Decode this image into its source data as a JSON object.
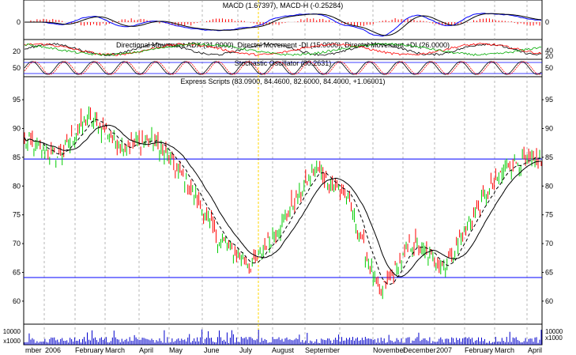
{
  "chart_data": [
    {
      "type": "line",
      "panel": "macd",
      "title": "MACD (1.67397), MACD-H (-0.25284)",
      "yticks": [
        0
      ],
      "series": [
        {
          "name": "MACD",
          "color": "#0000ff"
        },
        {
          "name": "MACD-H",
          "color": "#ff0000"
        }
      ]
    },
    {
      "type": "line",
      "panel": "dmi",
      "title": "Directional Movement ADX (31.0000), Directnl Movement -DI (15.0000), Directnl Movement +DI (26.0000)",
      "yticks": [
        20
      ],
      "yticks_right": [
        40,
        20
      ],
      "series": [
        {
          "name": "Directional Movement ADX",
          "value": 31.0,
          "color": "#000000"
        },
        {
          "name": "Directnl Movement -DI",
          "value": 15.0,
          "color": "#ff0000"
        },
        {
          "name": "Directnl Movement +DI",
          "value": 26.0,
          "color": "#00aa00"
        }
      ]
    },
    {
      "type": "line",
      "panel": "stochastic",
      "title": "Stochastic Oscillator (80.2631)",
      "yticks": [
        50
      ],
      "value": 80.2631
    },
    {
      "type": "line",
      "panel": "price",
      "title": "Express Scripts (83.0900, 84.4600, 82.6000, 84.4000, +1.06001)",
      "ylim": [
        56,
        99
      ],
      "yticks": [
        95,
        90,
        85,
        80,
        75,
        70,
        65,
        60
      ],
      "horizontal_lines": [
        84.7,
        64.1
      ],
      "x": [
        "Dec",
        "Jan 2006",
        "Feb",
        "Mar",
        "Apr",
        "May",
        "Jun",
        "Jul",
        "Aug",
        "Sep",
        "Oct",
        "Nov",
        "Dec",
        "Jan 2007",
        "Feb",
        "Mar",
        "Apr"
      ],
      "series": [
        {
          "name": "Close",
          "values": [
            88,
            85,
            92,
            87,
            88,
            81,
            71,
            66,
            74,
            83,
            78,
            61,
            70,
            66,
            76,
            84,
            84.4
          ]
        }
      ]
    },
    {
      "type": "bar",
      "panel": "volume",
      "yticks": [
        "10000",
        "x1000"
      ],
      "yticks_right": [
        "10000",
        "x1000"
      ]
    }
  ],
  "xaxis": {
    "labels": [
      "mber",
      "2006",
      "February",
      "March",
      "April",
      "May",
      "June",
      "July",
      "August",
      "September",
      "November",
      "December",
      "2007",
      "February",
      "March",
      "April"
    ]
  },
  "colors": {
    "up": "#00cc00",
    "down": "#ff0000",
    "ma": "#000000",
    "hline": "#0000ff",
    "highlight": "#ffd700"
  }
}
